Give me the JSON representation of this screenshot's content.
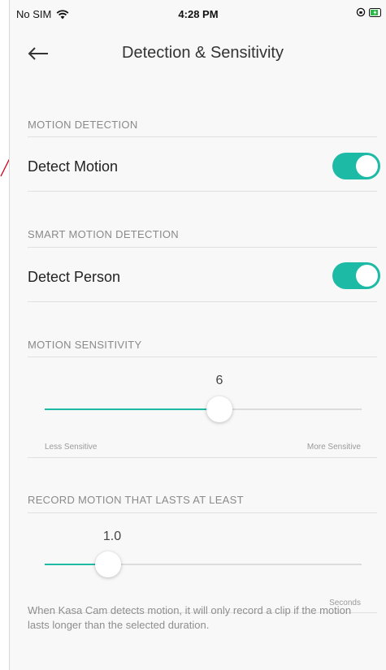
{
  "status_bar": {
    "carrier": "No SIM",
    "time": "4:28 PM"
  },
  "header": {
    "title": "Detection & Sensitivity",
    "back_icon": "arrow-left-icon"
  },
  "sections": {
    "motion_detection": {
      "label": "MOTION DETECTION",
      "row_label": "Detect Motion",
      "enabled": true
    },
    "smart_motion_detection": {
      "label": "SMART MOTION DETECTION",
      "row_label": "Detect Person",
      "enabled": true
    },
    "motion_sensitivity": {
      "label": "MOTION SENSITIVITY",
      "value": "6",
      "level_fraction": 0.55,
      "min_label": "Less Sensitive",
      "max_label": "More Sensitive"
    },
    "record_motion": {
      "label": "RECORD MOTION THAT LASTS AT LEAST",
      "value": "1.0",
      "level_fraction": 0.2,
      "unit_label": "Seconds"
    }
  },
  "footnote": "When Kasa Cam detects motion, it will only record a clip if the motion lasts longer than the selected duration.",
  "colors": {
    "accent": "#1dbba6",
    "annotation_mark": "#d0021b"
  }
}
